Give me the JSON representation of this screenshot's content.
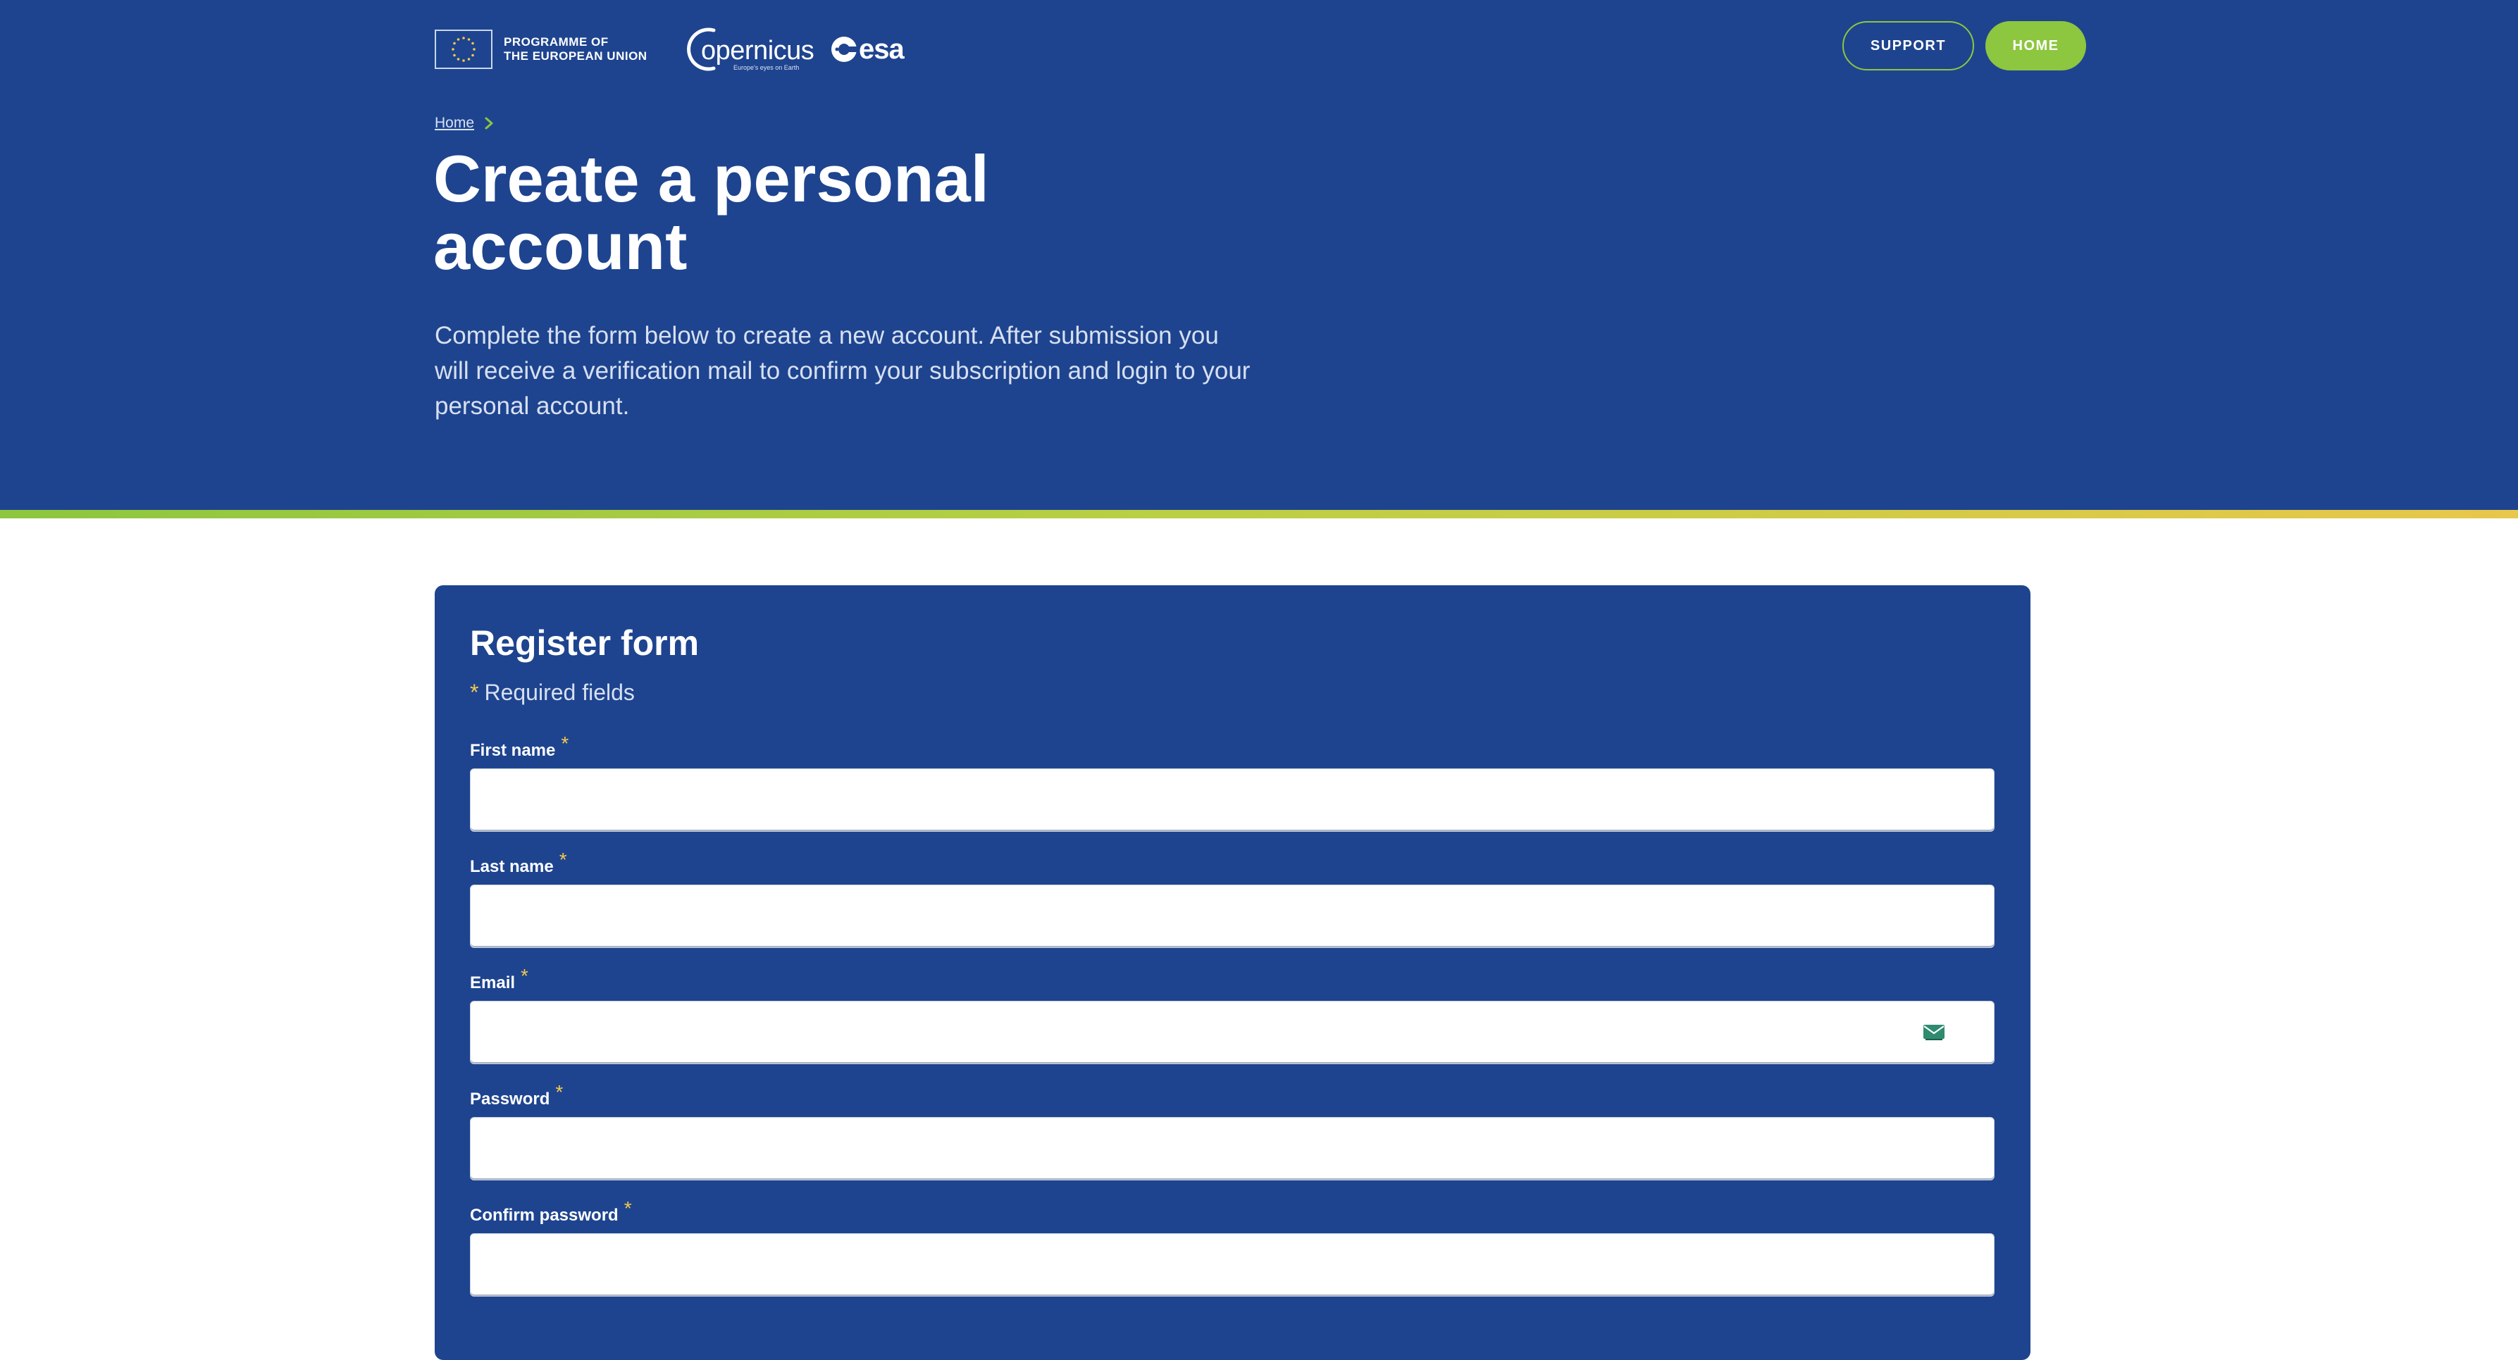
{
  "header": {
    "eu_programme_line1": "PROGRAMME OF",
    "eu_programme_line2": "THE EUROPEAN UNION",
    "copernicus_word": "opernicus",
    "copernicus_tagline": "Europe's eyes on Earth",
    "esa_word": "esa",
    "support_label": "SUPPORT",
    "home_label": "HOME"
  },
  "breadcrumb": {
    "home": "Home"
  },
  "hero": {
    "title": "Create a personal account",
    "intro": "Complete the form below to create a new account. After submission you will receive a verification mail to confirm your subscription and login to your personal account."
  },
  "form": {
    "title": "Register form",
    "required_star": "*",
    "required_note": "Required fields",
    "fields": [
      {
        "label": "First name",
        "value": ""
      },
      {
        "label": "Last name",
        "value": ""
      },
      {
        "label": "Email",
        "value": ""
      },
      {
        "label": "Password",
        "value": ""
      },
      {
        "label": "Confirm password",
        "value": ""
      }
    ]
  },
  "colors": {
    "brand_blue": "#1e448f",
    "accent_green": "#8dc63f",
    "accent_yellow": "#f2c94c",
    "email_icon": "#2e8b6f"
  },
  "icons": {
    "breadcrumb_separator": "chevron-right-icon",
    "email_field": "envelope-icon",
    "eu_logo": "eu-flag-icon",
    "esa_logo": "esa-logo-icon"
  }
}
